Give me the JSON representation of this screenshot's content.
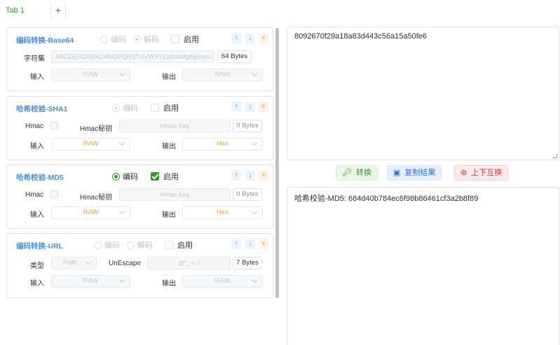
{
  "tabs": [
    {
      "label": "Tab 1"
    }
  ],
  "tab_add": "+",
  "cards": {
    "base64": {
      "title": "编码转换-Base64",
      "encode": "编码",
      "decode": "解码",
      "enable": "启用",
      "charset_label": "字符集",
      "charset_value": "ABCDEFGHIJKLMNOPQRSTUVWXYZabcdefghijklmnc",
      "bytes": "64 Bytes",
      "input_label": "输入",
      "input_value": "RAW",
      "output_label": "输出",
      "output_value": "RAW"
    },
    "sha1": {
      "title": "哈希校验-SHA1",
      "encode": "编码",
      "enable": "启用",
      "hmac_label": "Hmac",
      "hmac_key_label": "Hmac秘钥",
      "hmac_key_placeholder": "Hmac Key",
      "bytes": "0 Bytes",
      "input_label": "输入",
      "input_value": "RAW",
      "output_label": "输出",
      "output_value": "Hex"
    },
    "md5": {
      "title": "哈希校验-MD5",
      "encode": "编码",
      "enable": "启用",
      "hmac_label": "Hmac",
      "hmac_key_label": "Hmac秘钥",
      "hmac_key_placeholder": "Hmac Key",
      "bytes": "0 Bytes",
      "input_label": "输入",
      "input_value": "RAW",
      "output_label": "输出",
      "output_value": "Hex"
    },
    "url": {
      "title": "编码转换-URL",
      "encode": "编码",
      "decode": "解码",
      "enable": "启用",
      "type_label": "类型",
      "type_value": "Path",
      "unescape_label": "UnEscape",
      "unescape_value": "@*_+-./",
      "bytes": "7 Bytes",
      "input_label": "输入",
      "input_value": "RAW",
      "output_label": "输出",
      "output_value": "RAW"
    }
  },
  "controls": {
    "up": "↑",
    "down": "↓",
    "close": "×"
  },
  "input_text": "8092670f29a18a83d443c56a15a50fe6",
  "output_text": "哈希校验-MD5: 684d40b784ec6f98b86461cf3a2b8f89",
  "buttons": {
    "convert": "转换",
    "copy": "复制结果",
    "swap": "上下互换"
  },
  "colors": {
    "accent": "#2ea121",
    "title_blue": "#4a90e2",
    "warning_orange": "#e6a23c"
  }
}
